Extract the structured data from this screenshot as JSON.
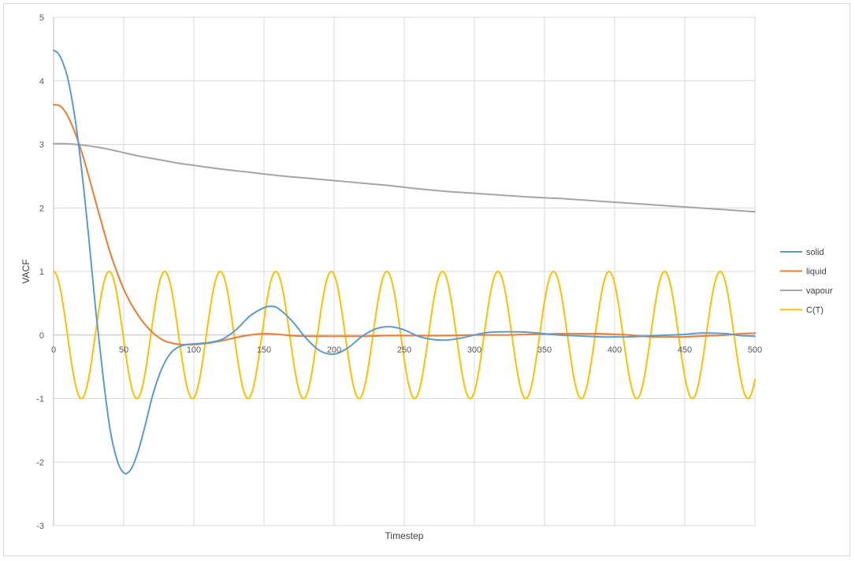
{
  "chart_data": {
    "type": "line",
    "title": "",
    "xlabel": "Timestep",
    "ylabel": "VACF",
    "xlim": [
      0,
      500
    ],
    "ylim": [
      -3,
      5
    ],
    "x_ticks": [
      0,
      50,
      100,
      150,
      200,
      250,
      300,
      350,
      400,
      450,
      500
    ],
    "y_ticks": [
      -3,
      -2,
      -1,
      0,
      1,
      2,
      3,
      4,
      5
    ],
    "grid": true,
    "legend_position": "right",
    "series": [
      {
        "name": "solid",
        "color": "#5B9BD5",
        "points": [
          [
            0,
            4.48
          ],
          [
            3,
            4.44
          ],
          [
            6,
            4.32
          ],
          [
            10,
            4.05
          ],
          [
            15,
            3.45
          ],
          [
            20,
            2.6
          ],
          [
            25,
            1.55
          ],
          [
            30,
            0.4
          ],
          [
            35,
            -0.6
          ],
          [
            40,
            -1.45
          ],
          [
            45,
            -1.95
          ],
          [
            50,
            -2.17
          ],
          [
            55,
            -2.12
          ],
          [
            60,
            -1.85
          ],
          [
            65,
            -1.45
          ],
          [
            70,
            -1.0
          ],
          [
            75,
            -0.65
          ],
          [
            80,
            -0.4
          ],
          [
            85,
            -0.25
          ],
          [
            90,
            -0.18
          ],
          [
            95,
            -0.15
          ],
          [
            100,
            -0.14
          ],
          [
            110,
            -0.12
          ],
          [
            120,
            -0.07
          ],
          [
            130,
            0.08
          ],
          [
            140,
            0.3
          ],
          [
            150,
            0.43
          ],
          [
            155,
            0.45
          ],
          [
            160,
            0.42
          ],
          [
            170,
            0.22
          ],
          [
            180,
            -0.05
          ],
          [
            190,
            -0.25
          ],
          [
            200,
            -0.3
          ],
          [
            210,
            -0.2
          ],
          [
            220,
            -0.02
          ],
          [
            230,
            0.1
          ],
          [
            240,
            0.13
          ],
          [
            250,
            0.08
          ],
          [
            260,
            -0.02
          ],
          [
            270,
            -0.07
          ],
          [
            280,
            -0.08
          ],
          [
            290,
            -0.05
          ],
          [
            300,
            0.0
          ],
          [
            310,
            0.04
          ],
          [
            320,
            0.05
          ],
          [
            330,
            0.05
          ],
          [
            340,
            0.04
          ],
          [
            350,
            0.02
          ],
          [
            360,
            0.0
          ],
          [
            370,
            -0.01
          ],
          [
            380,
            -0.02
          ],
          [
            390,
            -0.03
          ],
          [
            400,
            -0.03
          ],
          [
            410,
            -0.03
          ],
          [
            420,
            -0.02
          ],
          [
            430,
            -0.01
          ],
          [
            440,
            0.0
          ],
          [
            450,
            0.01
          ],
          [
            460,
            0.03
          ],
          [
            470,
            0.03
          ],
          [
            480,
            0.02
          ],
          [
            490,
            -0.01
          ],
          [
            500,
            -0.02
          ]
        ]
      },
      {
        "name": "liquid",
        "color": "#ED7D31",
        "points": [
          [
            0,
            3.62
          ],
          [
            3,
            3.62
          ],
          [
            6,
            3.58
          ],
          [
            10,
            3.45
          ],
          [
            15,
            3.2
          ],
          [
            20,
            2.88
          ],
          [
            25,
            2.5
          ],
          [
            30,
            2.1
          ],
          [
            35,
            1.7
          ],
          [
            40,
            1.32
          ],
          [
            45,
            1.0
          ],
          [
            50,
            0.72
          ],
          [
            55,
            0.5
          ],
          [
            60,
            0.32
          ],
          [
            65,
            0.17
          ],
          [
            70,
            0.05
          ],
          [
            75,
            -0.04
          ],
          [
            80,
            -0.1
          ],
          [
            85,
            -0.13
          ],
          [
            90,
            -0.15
          ],
          [
            95,
            -0.15
          ],
          [
            100,
            -0.15
          ],
          [
            110,
            -0.13
          ],
          [
            120,
            -0.09
          ],
          [
            130,
            -0.04
          ],
          [
            140,
            0.0
          ],
          [
            150,
            0.02
          ],
          [
            160,
            0.01
          ],
          [
            170,
            -0.01
          ],
          [
            180,
            -0.02
          ],
          [
            200,
            -0.02
          ],
          [
            220,
            -0.02
          ],
          [
            240,
            -0.01
          ],
          [
            260,
            -0.01
          ],
          [
            280,
            -0.01
          ],
          [
            300,
            0.0
          ],
          [
            320,
            0.0
          ],
          [
            340,
            0.01
          ],
          [
            360,
            0.02
          ],
          [
            370,
            0.02
          ],
          [
            380,
            0.02
          ],
          [
            390,
            0.02
          ],
          [
            400,
            0.01
          ],
          [
            410,
            0.0
          ],
          [
            420,
            -0.02
          ],
          [
            430,
            -0.03
          ],
          [
            440,
            -0.03
          ],
          [
            450,
            -0.03
          ],
          [
            460,
            -0.02
          ],
          [
            470,
            -0.01
          ],
          [
            480,
            0.0
          ],
          [
            490,
            0.02
          ],
          [
            500,
            0.03
          ]
        ]
      },
      {
        "name": "vapour",
        "color": "#A5A5A5",
        "points": [
          [
            0,
            3.01
          ],
          [
            10,
            3.01
          ],
          [
            20,
            2.99
          ],
          [
            30,
            2.96
          ],
          [
            40,
            2.92
          ],
          [
            50,
            2.87
          ],
          [
            60,
            2.82
          ],
          [
            70,
            2.78
          ],
          [
            80,
            2.74
          ],
          [
            90,
            2.7
          ],
          [
            100,
            2.67
          ],
          [
            120,
            2.61
          ],
          [
            140,
            2.56
          ],
          [
            160,
            2.51
          ],
          [
            180,
            2.47
          ],
          [
            200,
            2.43
          ],
          [
            220,
            2.39
          ],
          [
            240,
            2.35
          ],
          [
            260,
            2.3
          ],
          [
            280,
            2.26
          ],
          [
            300,
            2.23
          ],
          [
            320,
            2.2
          ],
          [
            340,
            2.17
          ],
          [
            360,
            2.15
          ],
          [
            380,
            2.12
          ],
          [
            400,
            2.09
          ],
          [
            420,
            2.06
          ],
          [
            440,
            2.03
          ],
          [
            460,
            2.0
          ],
          [
            480,
            1.97
          ],
          [
            500,
            1.94
          ]
        ]
      },
      {
        "name": "C(T)",
        "color": "#FFC000",
        "period": 39.6,
        "amplitude": 1,
        "x_end": 500,
        "y_at_x_end": -0.75
      }
    ]
  }
}
